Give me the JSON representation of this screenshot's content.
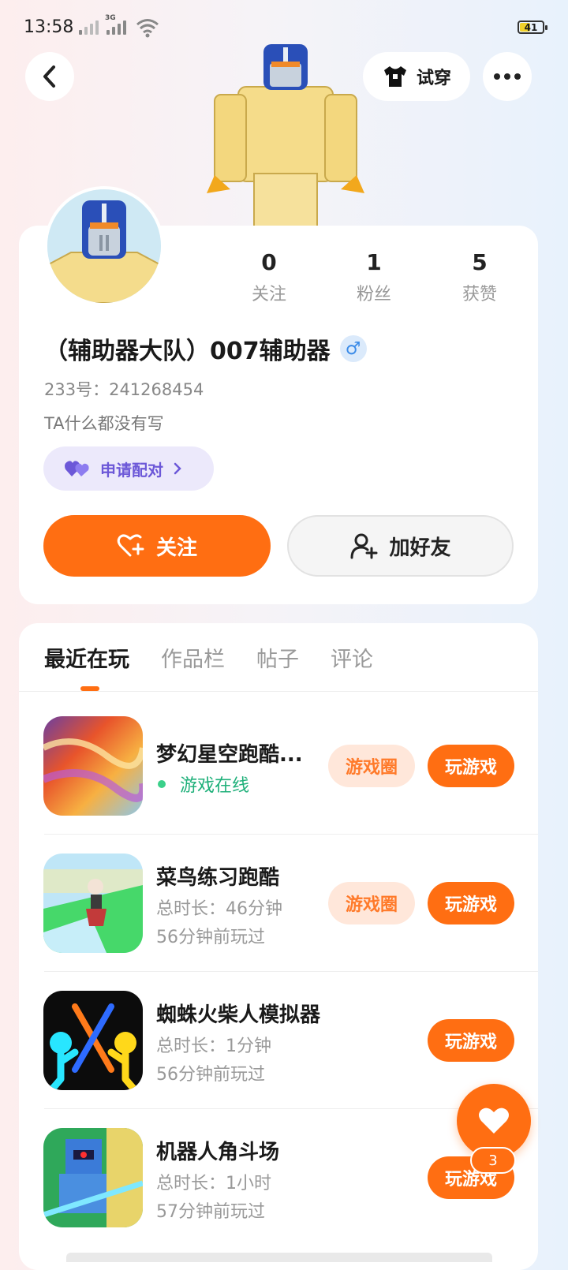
{
  "status_bar": {
    "time": "13:58",
    "network": "3G",
    "battery": "41"
  },
  "nav": {
    "try_on_label": "试穿"
  },
  "profile": {
    "stats": [
      {
        "value": "0",
        "label": "关注"
      },
      {
        "value": "1",
        "label": "粉丝"
      },
      {
        "value": "5",
        "label": "获赞"
      }
    ],
    "username": "（辅助器大队）007辅助器",
    "gender_symbol": "♂",
    "user_id": "233号：241268454",
    "bio": "TA什么都没有写",
    "pair_label": "申请配对",
    "follow_label": "关注",
    "add_friend_label": "加好友"
  },
  "tabs": [
    "最近在玩",
    "作品栏",
    "帖子",
    "评论"
  ],
  "games": [
    {
      "name": "梦幻星空跑酷...",
      "online_text": "游戏在线",
      "circle_label": "游戏圈",
      "play_label": "玩游戏"
    },
    {
      "name": "菜鸟练习跑酷",
      "duration": "总时长：46分钟",
      "last_played": "56分钟前玩过",
      "circle_label": "游戏圈",
      "play_label": "玩游戏"
    },
    {
      "name": "蜘蛛火柴人模拟器",
      "duration": "总时长：1分钟",
      "last_played": "56分钟前玩过",
      "play_label": "玩游戏"
    },
    {
      "name": "机器人角斗场",
      "duration": "总时长：1小时",
      "last_played": "57分钟前玩过",
      "play_label": "玩游戏"
    }
  ],
  "fab": {
    "badge_count": "3"
  },
  "colors": {
    "accent": "#ff6e12",
    "online": "#1fb07a",
    "pair": "#6c58d8"
  }
}
